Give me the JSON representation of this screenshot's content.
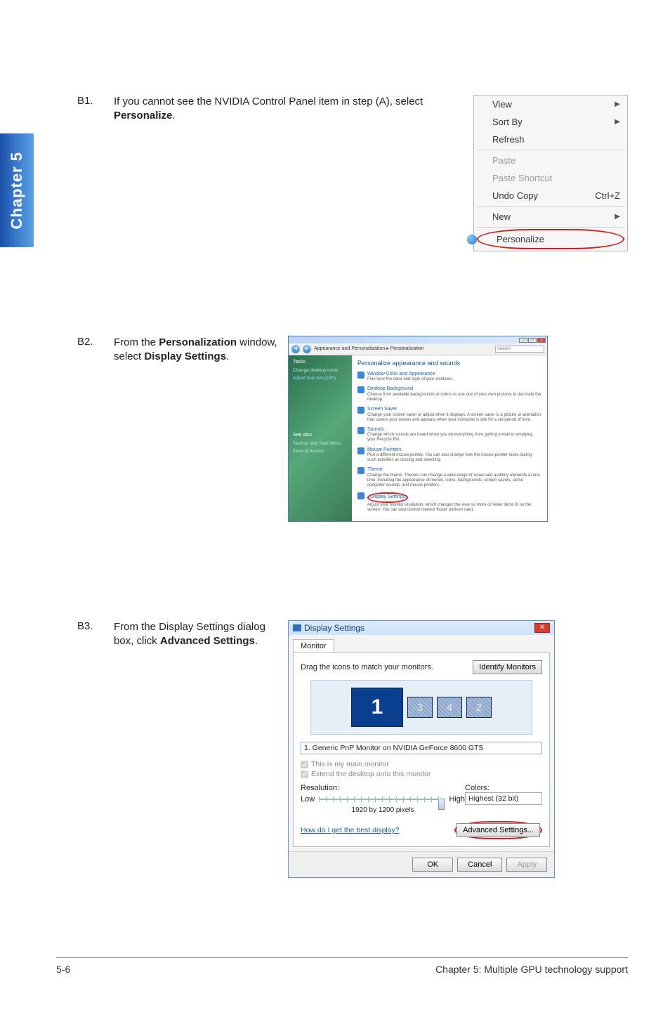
{
  "chapter_tab": "Chapter 5",
  "steps": {
    "b1": {
      "num": "B1.",
      "text_before": "If you cannot see the NVIDIA Control Panel item in step (A), select ",
      "bold": "Personalize",
      "text_after": "."
    },
    "b2": {
      "num": "B2.",
      "text_before": "From the ",
      "bold1": "Personalization",
      "mid": " window, select ",
      "bold2": "Display Settings",
      "text_after": "."
    },
    "b3": {
      "num": "B3.",
      "text_before": "From the Display Settings dialog box, click ",
      "bold": "Advanced Settings",
      "text_after": "."
    }
  },
  "context_menu": {
    "items": [
      {
        "label": "View",
        "arrow": true
      },
      {
        "label": "Sort By",
        "arrow": true
      },
      {
        "label": "Refresh"
      }
    ],
    "group2": [
      {
        "label": "Paste",
        "disabled": true
      },
      {
        "label": "Paste Shortcut",
        "disabled": true
      },
      {
        "label": "Undo Copy",
        "shortcut": "Ctrl+Z"
      }
    ],
    "group3": [
      {
        "label": "New",
        "arrow": true
      }
    ],
    "personalize": "Personalize"
  },
  "personalization_window": {
    "breadcrumb": "Appearance and Personalization  ▸  Personalization",
    "search_placeholder": "Search",
    "sidebar": {
      "heading": "Tasks",
      "links": [
        "Change desktop icons",
        "Adjust font size (DPI)"
      ],
      "see_also": "See also",
      "see_links": [
        "Taskbar and Start Menu",
        "Ease of Access"
      ]
    },
    "title": "Personalize appearance and sounds",
    "items": [
      {
        "t": "Window Color and Appearance",
        "d": "Fine tune the color and style of your windows."
      },
      {
        "t": "Desktop Background",
        "d": "Choose from available backgrounds or colors or use one of your own pictures to decorate the desktop."
      },
      {
        "t": "Screen Saver",
        "d": "Change your screen saver or adjust when it displays. A screen saver is a picture or animation that covers your screen and appears when your computer is idle for a set period of time."
      },
      {
        "t": "Sounds",
        "d": "Change which sounds are heard when you do everything from getting e-mail to emptying your Recycle Bin."
      },
      {
        "t": "Mouse Pointers",
        "d": "Pick a different mouse pointer. You can also change how the mouse pointer looks during such activities as clicking and selecting."
      },
      {
        "t": "Theme",
        "d": "Change the theme. Themes can change a wide range of visual and auditory elements at one time, including the appearance of menus, icons, backgrounds, screen savers, some computer sounds, and mouse pointers."
      },
      {
        "t": "Display Settings",
        "d": "Adjust your monitor resolution, which changes the view so more or fewer items fit on the screen. You can also control monitor flicker (refresh rate)."
      }
    ]
  },
  "display_settings": {
    "title": "Display Settings",
    "tab": "Monitor",
    "drag_text": "Drag the icons to match your monitors.",
    "identify_btn": "Identify Monitors",
    "monitors": [
      "1",
      "3",
      "4",
      "2"
    ],
    "select": "1. Generic PnP Monitor on NVIDIA GeForce 8600 GTS",
    "chk_main": "This is my main monitor",
    "chk_extend": "Extend the desktop onto this monitor",
    "res_label": "Resolution:",
    "low": "Low",
    "high": "High",
    "res_value": "1920 by 1200 pixels",
    "colors_label": "Colors:",
    "colors_value": "Highest (32 bit)",
    "help_link": "How do I get the best display?",
    "adv_btn": "Advanced Settings...",
    "ok": "OK",
    "cancel": "Cancel",
    "apply": "Apply"
  },
  "footer": {
    "left": "5-6",
    "right": "Chapter 5: Multiple GPU technology support"
  }
}
